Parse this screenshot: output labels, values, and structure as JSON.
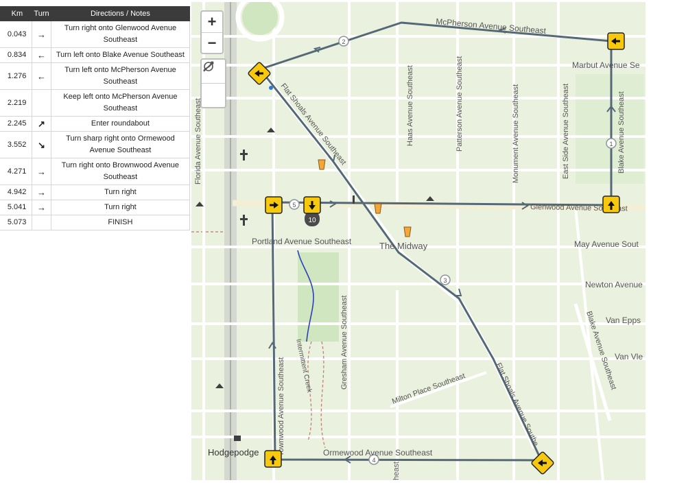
{
  "table": {
    "headers": [
      "",
      "Km",
      "Turn",
      "Directions / Notes"
    ],
    "rows": [
      {
        "km": "0.043",
        "turn": "→",
        "note": "Turn right onto Glenwood Avenue Southeast"
      },
      {
        "km": "0.834",
        "turn": "←",
        "note": "Turn left onto Blake Avenue Southeast"
      },
      {
        "km": "1.276",
        "turn": "←",
        "note": "Turn left onto McPherson Avenue Southeast"
      },
      {
        "km": "2.219",
        "turn": "",
        "note": "Keep left onto McPherson Avenue Southeast"
      },
      {
        "km": "2.245",
        "turn": "↗",
        "note": "Enter roundabout"
      },
      {
        "km": "3.552",
        "turn": "↘",
        "note": "Turn sharp right onto Ormewood Avenue Southeast"
      },
      {
        "km": "4.271",
        "turn": "→",
        "note": "Turn right onto Brownwood Avenue Southeast"
      },
      {
        "km": "4.942",
        "turn": "→",
        "note": "Turn right"
      },
      {
        "km": "5.041",
        "turn": "→",
        "note": "Turn right"
      },
      {
        "km": "5.073",
        "turn": "",
        "note": "FINISH"
      }
    ]
  },
  "map": {
    "controls": {
      "zoom_in": "+",
      "zoom_out": "−"
    },
    "street_labels": {
      "mcpherson": "McPherson Avenue Southeast",
      "marbut": "Marbut Avenue Se",
      "flat_shoals_n": "Flat Shoals Avenue Southeast",
      "flat_shoals_s": "Flat Shoals Avenue Southe",
      "haas": "Haas Avenue Southeast",
      "patterson": "Patterson Avenue Southeast",
      "monument": "Monument Avenue Southeast",
      "east_side": "East Side Avenue Southeast",
      "blake_n": "Blake Avenue Southeast",
      "blake_s": "Blake Avenue Southeast",
      "florida": "Florida Avenue Southeast",
      "glenwood": "Glenwood Avenue Southeast",
      "may": "May Avenue Sout",
      "portland": "Portland Avenue Southeast",
      "midway": "The Midway",
      "newton": "Newton Avenue",
      "van_epps": "Van Epps",
      "van_vleck": "Van Vle",
      "gresham": "Gresham Avenue Southeast",
      "creek": "Intermittent Creek",
      "milton": "Milton Place Southeast",
      "brownwood": "rownwood Avenue Southeast",
      "ormewood": "Ormewood Avenue Southeast",
      "hodgepodge": "Hodgepodge",
      "heast": "heast"
    },
    "waypoints": [
      "1",
      "2",
      "3",
      "4",
      "5"
    ],
    "marker_10": "10",
    "colors": {
      "route": "#556877",
      "sign": "#f7c90e",
      "road": "#ffffff",
      "land": "#eaf2df"
    }
  }
}
